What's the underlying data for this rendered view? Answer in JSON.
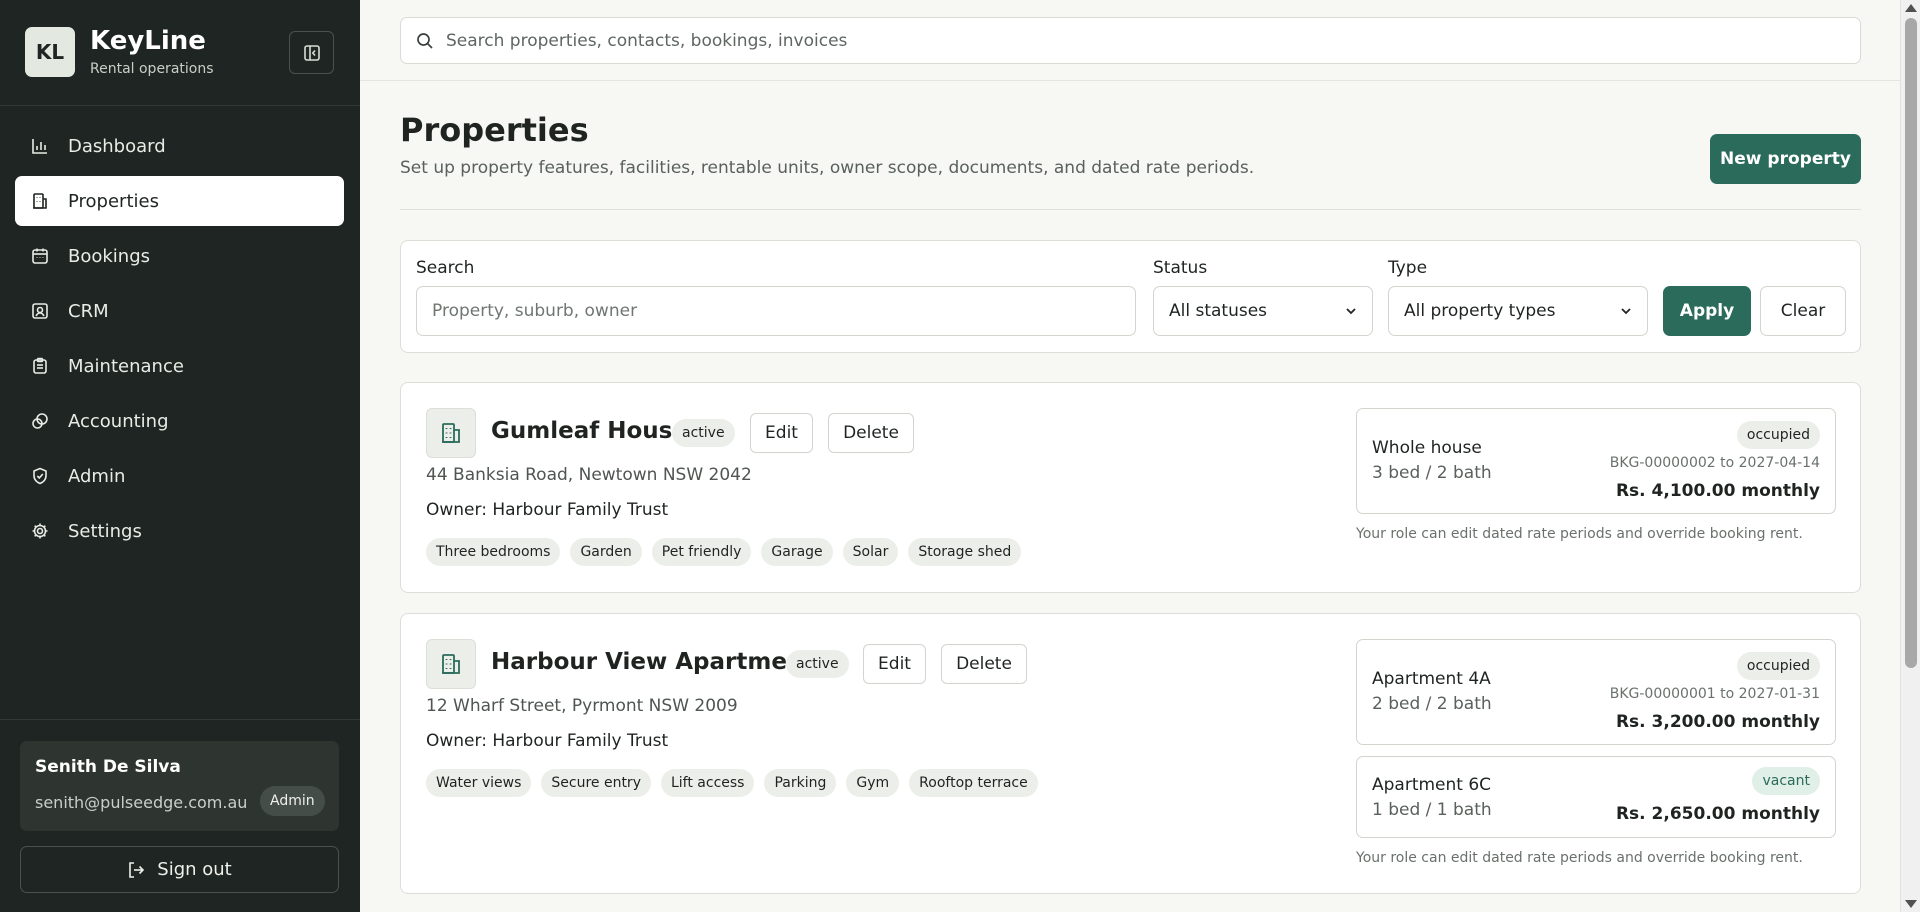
{
  "app": {
    "logo_initials": "KL",
    "name": "KeyLine",
    "subtitle": "Rental operations"
  },
  "sidebar": {
    "items": [
      {
        "label": "Dashboard",
        "icon": "chart-icon",
        "active": false
      },
      {
        "label": "Properties",
        "icon": "building-icon",
        "active": true
      },
      {
        "label": "Bookings",
        "icon": "calendar-icon",
        "active": false
      },
      {
        "label": "CRM",
        "icon": "contact-icon",
        "active": false
      },
      {
        "label": "Maintenance",
        "icon": "clipboard-icon",
        "active": false
      },
      {
        "label": "Accounting",
        "icon": "coins-icon",
        "active": false
      },
      {
        "label": "Admin",
        "icon": "shield-icon",
        "active": false
      },
      {
        "label": "Settings",
        "icon": "gear-icon",
        "active": false
      }
    ],
    "user": {
      "name": "Senith De Silva",
      "email": "senith@pulseedge.com.au",
      "role": "Admin"
    },
    "signout_label": "Sign out"
  },
  "search": {
    "placeholder": "Search properties, contacts, bookings, invoices"
  },
  "page": {
    "title": "Properties",
    "subtitle": "Set up property features, facilities, rentable units, owner scope, documents, and dated rate periods.",
    "new_button": "New property"
  },
  "filters": {
    "search_label": "Search",
    "search_placeholder": "Property, suburb, owner",
    "status_label": "Status",
    "status_value": "All statuses",
    "type_label": "Type",
    "type_value": "All property types",
    "apply_label": "Apply",
    "clear_label": "Clear"
  },
  "properties": [
    {
      "name": "Gumleaf House",
      "status": "active",
      "edit_label": "Edit",
      "delete_label": "Delete",
      "address": "44 Banksia Road, Newtown NSW 2042",
      "owner": "Owner: Harbour Family Trust",
      "tags": [
        "Three bedrooms",
        "Garden",
        "Pet friendly",
        "Garage",
        "Solar",
        "Storage shed"
      ],
      "units": [
        {
          "name": "Whole house",
          "beds": "3 bed / 2 bath",
          "status": "occupied",
          "booking": "BKG-00000002 to 2027-04-14",
          "rent": "Rs. 4,100.00 monthly"
        }
      ],
      "role_note": "Your role can edit dated rate periods and override booking rent."
    },
    {
      "name": "Harbour View Apartments",
      "status": "active",
      "edit_label": "Edit",
      "delete_label": "Delete",
      "address": "12 Wharf Street, Pyrmont NSW 2009",
      "owner": "Owner: Harbour Family Trust",
      "tags": [
        "Water views",
        "Secure entry",
        "Lift access",
        "Parking",
        "Gym",
        "Rooftop terrace"
      ],
      "units": [
        {
          "name": "Apartment 4A",
          "beds": "2 bed / 2 bath",
          "status": "occupied",
          "booking": "BKG-00000001 to 2027-01-31",
          "rent": "Rs. 3,200.00 monthly"
        },
        {
          "name": "Apartment 6C",
          "beds": "1 bed / 1 bath",
          "status": "vacant",
          "booking": "",
          "rent": "Rs. 2,650.00 monthly"
        }
      ],
      "role_note": "Your role can edit dated rate periods and override booking rent."
    }
  ],
  "colors": {
    "sidebar_bg": "#1f2522",
    "accent": "#2b6b5b",
    "page_bg": "#f7f7f4",
    "vacant_bg": "#e0efe8"
  }
}
